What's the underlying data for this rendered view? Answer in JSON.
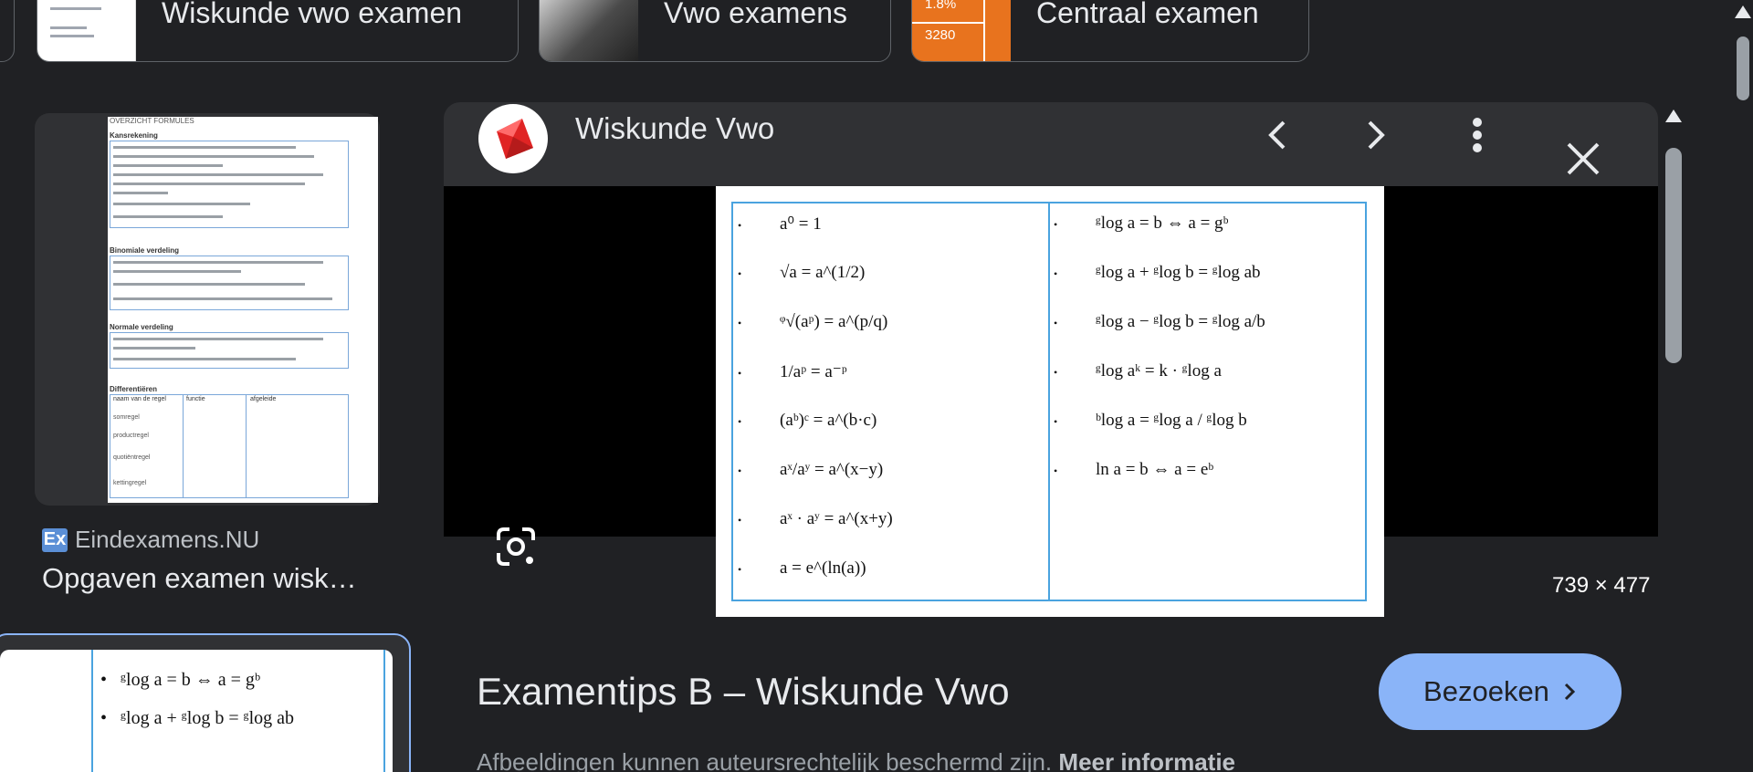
{
  "chips": [
    {
      "label": "Wiskunde vwo examen"
    },
    {
      "label": "Vwo examens"
    },
    {
      "label": "Centraal examen",
      "thumb_values": [
        "1.8%",
        "3280"
      ]
    }
  ],
  "left_result": {
    "source": "Eindexamens.NU",
    "source_logo": "Ex",
    "title": "Opgaven examen wisk…",
    "doc_heading": "OVERZICHT FORMULES",
    "doc_section_1": "Kansrekening",
    "doc_section_2": "Binomiale verdeling",
    "doc_section_3": "Normale verdeling",
    "doc_section_4": "Differentiëren",
    "table_headers": [
      "naam van de regel",
      "functie",
      "afgeleide"
    ],
    "table_rows": [
      "somregel",
      "productregel",
      "quotiëntregel",
      "kettingregel"
    ]
  },
  "selected_preview": {
    "lines": [
      "ᵍlog a = b ⇔ a = gᵇ",
      "ᵍlog a + ᵍlog b = ᵍlog ab"
    ]
  },
  "panel": {
    "site_name": "Wiskunde Vwo",
    "prev_label": "‹",
    "next_label": "›",
    "dimensions": "739 × 477",
    "title": "Examentips B – Wiskunde Vwo",
    "visit_label": "Bezoeken",
    "copyright_text": "Afbeeldingen kunnen auteursrechtelijk beschermd zijn.",
    "more_info": "Meer informatie"
  },
  "formulas_left": [
    "a⁰ = 1",
    "√a = a^(1/2)",
    "ᵠ√(aᵖ) = a^(p/q)",
    "1/aᵖ = a⁻ᵖ",
    "(aᵇ)ᶜ = a^(b·c)",
    "aˣ/aʸ = a^(x−y)",
    "aˣ · aʸ = a^(x+y)",
    "a = e^(ln(a))"
  ],
  "formulas_right": [
    "ᵍlog a = b ⇔ a = gᵇ",
    "ᵍlog a + ᵍlog b = ᵍlog ab",
    "ᵍlog a − ᵍlog b = ᵍlog a/b",
    "ᵍlog aᵏ = k · ᵍlog a",
    "ᵇlog a = ᵍlog a / ᵍlog b",
    "ln a = b ⇔ a = eᵇ"
  ],
  "colors": {
    "accent": "#8ab4f8",
    "background": "#202124",
    "surface": "#303134"
  }
}
